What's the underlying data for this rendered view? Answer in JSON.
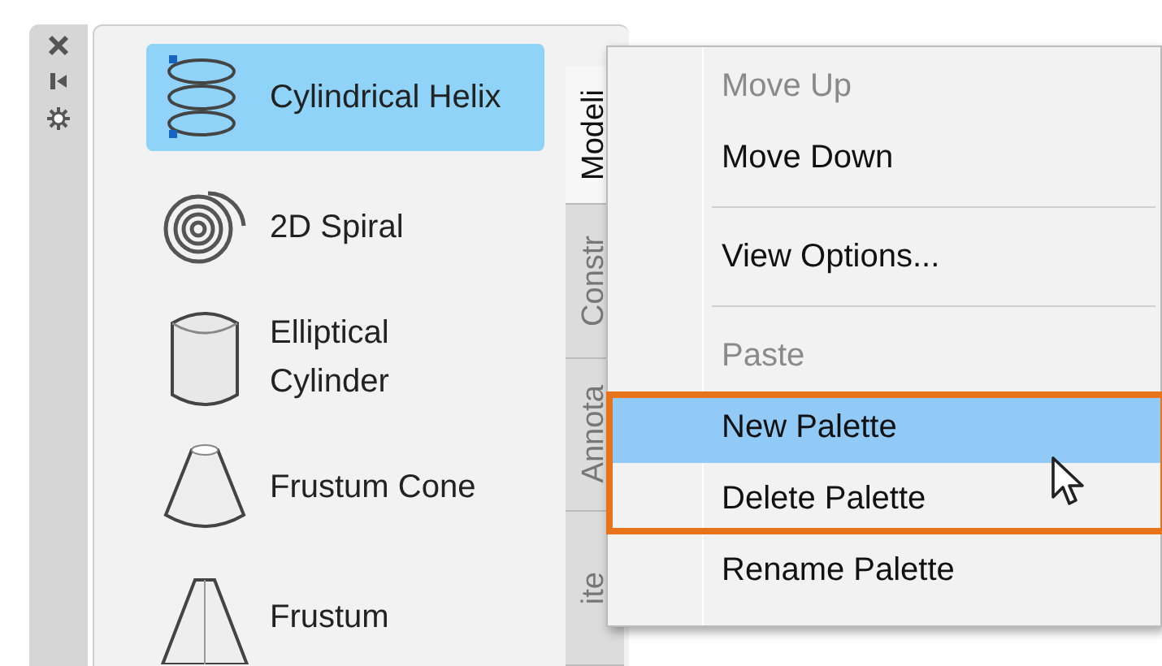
{
  "tools": [
    {
      "label": "Cylindrical Helix",
      "kind": "helix",
      "selected": true
    },
    {
      "label": "2D Spiral",
      "kind": "spiral",
      "selected": false
    },
    {
      "label": "Elliptical Cylinder",
      "kind": "cylinder",
      "selected": false
    },
    {
      "label": "Frustum Cone",
      "kind": "cone",
      "selected": false
    },
    {
      "label": "Frustum",
      "kind": "pyramid",
      "selected": false
    }
  ],
  "tabs": [
    {
      "label": "Modeli",
      "selected": true
    },
    {
      "label": "Constr",
      "selected": false
    },
    {
      "label": "Annota",
      "selected": false
    },
    {
      "label": "ite",
      "selected": false
    }
  ],
  "context_menu": {
    "items": [
      {
        "kind": "item",
        "label": "Move Up",
        "disabled": true,
        "selected": false
      },
      {
        "kind": "item",
        "label": "Move Down",
        "disabled": false,
        "selected": false
      },
      {
        "kind": "separator"
      },
      {
        "kind": "item",
        "label": "View Options...",
        "disabled": false,
        "selected": false
      },
      {
        "kind": "separator"
      },
      {
        "kind": "item",
        "label": "Paste",
        "disabled": true,
        "selected": false
      },
      {
        "kind": "item",
        "label": "New Palette",
        "disabled": false,
        "selected": true
      },
      {
        "kind": "item",
        "label": "Delete Palette",
        "disabled": false,
        "selected": false
      },
      {
        "kind": "item",
        "label": "Rename Palette",
        "disabled": false,
        "selected": false
      }
    ]
  }
}
